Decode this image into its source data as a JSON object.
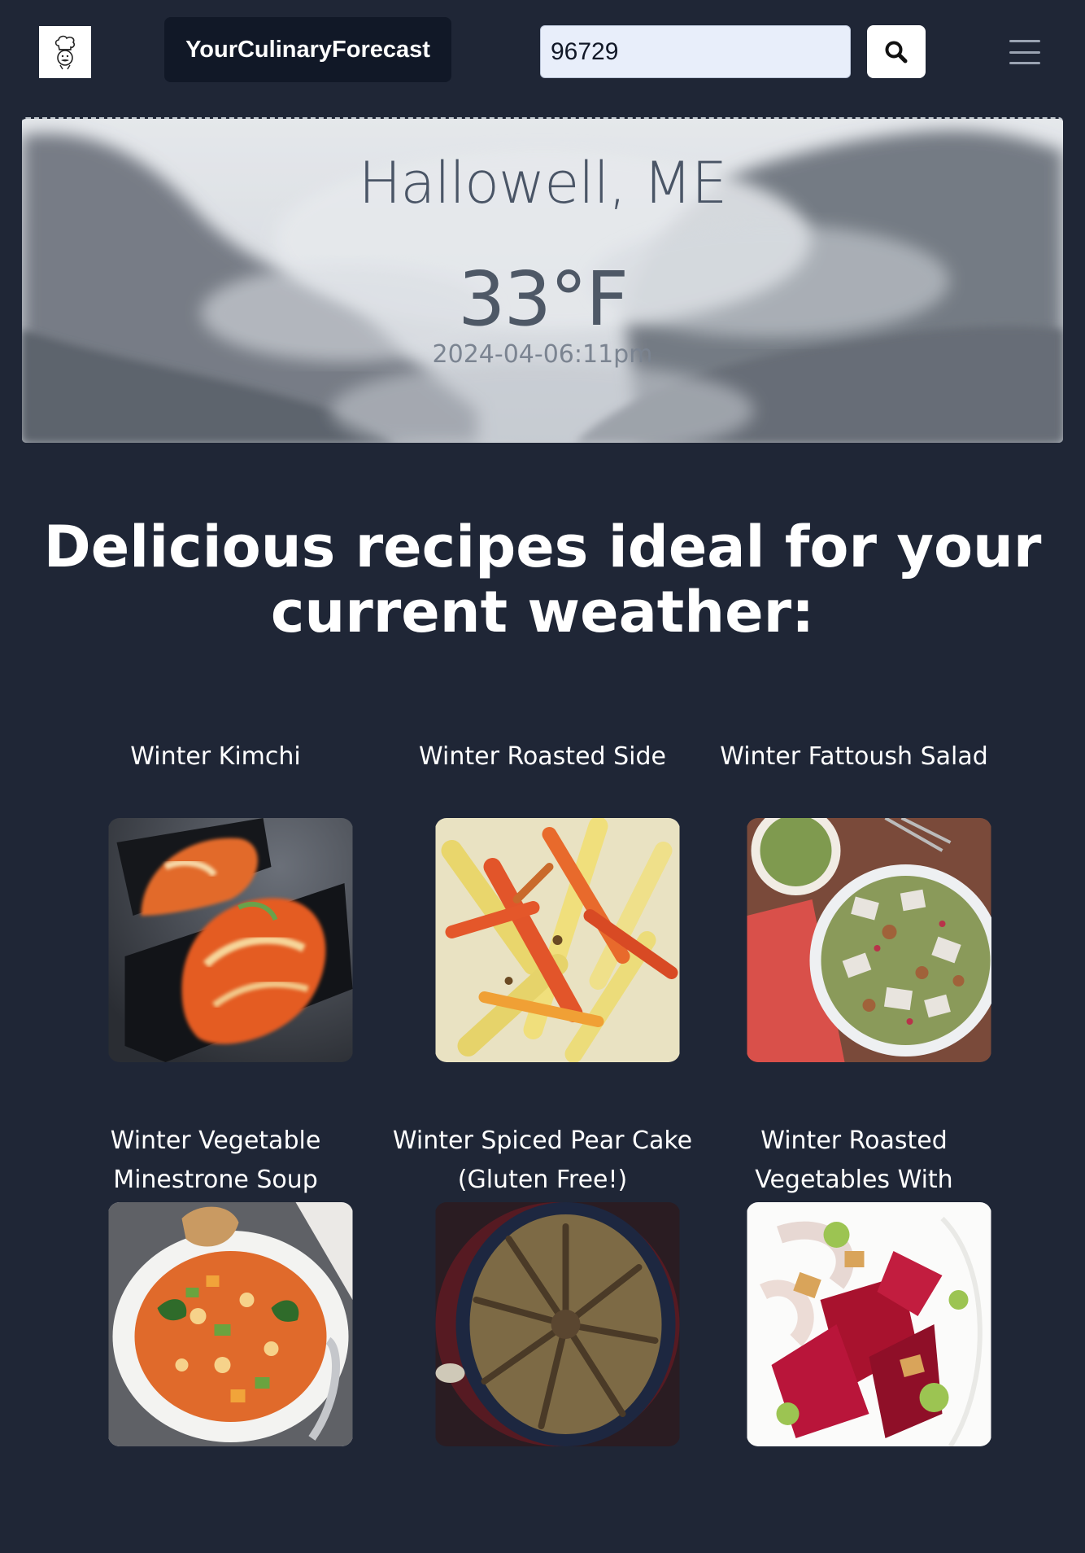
{
  "header": {
    "brand": "YourCulinaryForecast",
    "search_value": "96729",
    "logo_icon": "chef-icon",
    "search_icon": "search-icon",
    "menu_icon": "hamburger-menu-icon"
  },
  "weather": {
    "city": "Hallowell, ME",
    "temperature": "33°F",
    "datetime": "2024-04-06:11pm"
  },
  "section_title": "Delicious recipes ideal for your current weather:",
  "recipes": [
    {
      "title": "Winter Kimchi",
      "image": "kimchi"
    },
    {
      "title": "Winter Roasted Side",
      "image": "roasted-vegetables"
    },
    {
      "title": "Winter Fattoush Salad",
      "image": "fattoush-salad"
    },
    {
      "title": "Winter Vegetable Minestrone Soup",
      "image": "minestrone-soup"
    },
    {
      "title": "Winter Spiced Pear Cake (Gluten Free!)",
      "image": "pear-cake"
    },
    {
      "title": "Winter Roasted Vegetables With",
      "image": "roasted-beets"
    }
  ],
  "colors": {
    "background": "#1f2636",
    "brand_bg": "#111827",
    "search_bg": "#e8eefa"
  }
}
